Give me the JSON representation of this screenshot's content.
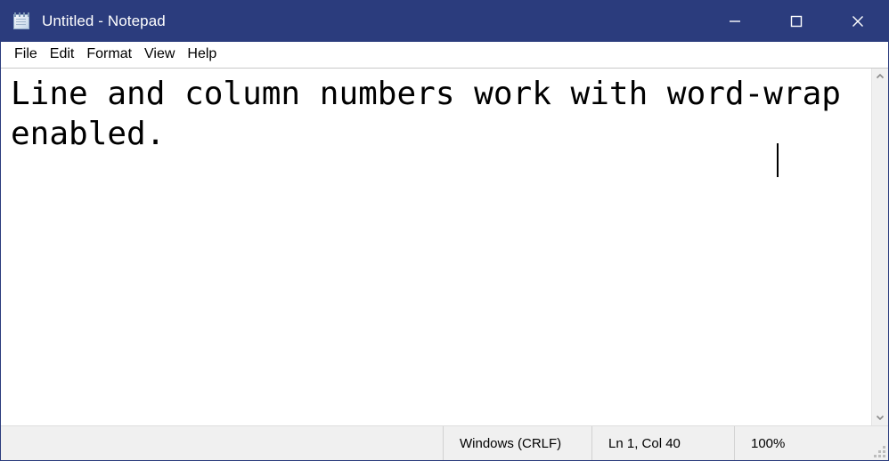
{
  "window": {
    "title": "Untitled - Notepad",
    "icon": "notepad-icon",
    "title_bar_color": "#2b3c7d",
    "title_text_color": "#ffffff"
  },
  "controls": {
    "minimize_label": "Minimize",
    "maximize_label": "Maximize",
    "close_label": "Close"
  },
  "menu": {
    "items": [
      {
        "label": "File"
      },
      {
        "label": "Edit"
      },
      {
        "label": "Format"
      },
      {
        "label": "View"
      },
      {
        "label": "Help"
      }
    ]
  },
  "editor": {
    "content": "Line and column numbers work with word-wrap enabled.",
    "font_color": "#000000",
    "background": "#ffffff",
    "caret_visible": true,
    "caret_after_text": "Line and column numbers work with word-",
    "word_wrap": true
  },
  "scrollbar": {
    "up_arrow": "chevron-up-icon",
    "down_arrow": "chevron-down-icon",
    "track_color": "#f0f0f0"
  },
  "status_bar": {
    "line_ending": "Windows (CRLF)",
    "cursor_position": "Ln 1, Col 40",
    "zoom": "100%",
    "background": "#f0f0f0"
  }
}
